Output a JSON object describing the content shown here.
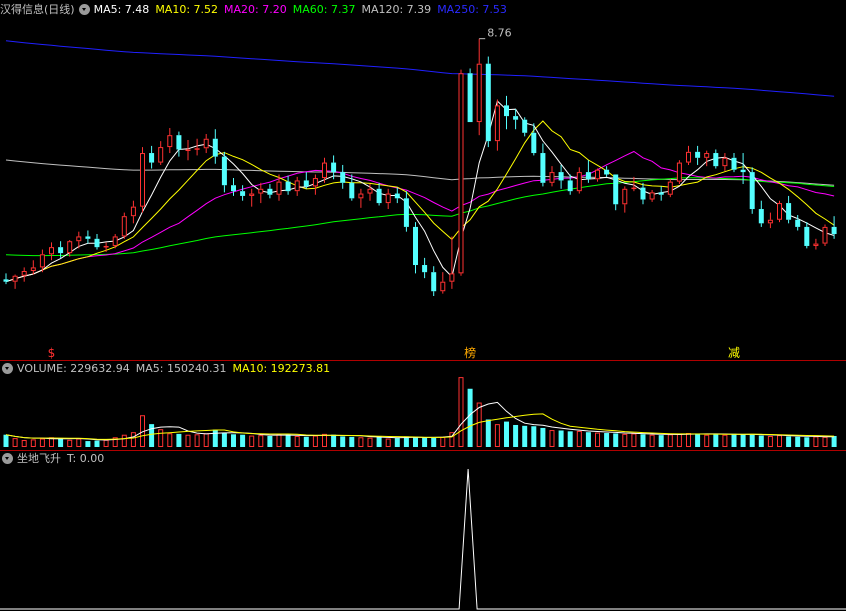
{
  "main": {
    "title": "汉得信息(日线)",
    "ma": [
      {
        "label": "MA5: 7.48",
        "color": "#ffffff"
      },
      {
        "label": "MA10: 7.52",
        "color": "#ffff00"
      },
      {
        "label": "MA20: 7.20",
        "color": "#ff00ff"
      },
      {
        "label": "MA60: 7.37",
        "color": "#00ff00"
      },
      {
        "label": "MA120: 7.39",
        "color": "#c0c0c0"
      },
      {
        "label": "MA250: 7.53",
        "color": "#0000ff"
      }
    ],
    "high_label": "8.76",
    "markers": [
      {
        "text": "$",
        "color": "#ff3030"
      },
      {
        "text": "榜",
        "color": "#ffaa00"
      },
      {
        "text": "减",
        "color": "#ffff00"
      }
    ]
  },
  "volume": {
    "labels": [
      {
        "text": "VOLUME: 229632.94",
        "color": "#c0c0c0"
      },
      {
        "text": "MA5: 150240.31",
        "color": "#c0c0c0"
      },
      {
        "text": "MA10: 192273.81",
        "color": "#ffff00"
      }
    ]
  },
  "indicator": {
    "labels": [
      {
        "text": "坐地飞升",
        "color": "#c0c0c0"
      },
      {
        "text": "T: 0.00",
        "color": "#c0c0c0"
      }
    ]
  },
  "colors": {
    "up": "#ff3232",
    "down": "#54ffff",
    "separator": "#b00000"
  },
  "chart_data": {
    "type": "candlestick",
    "candles": [
      [
        6.74,
        6.79,
        6.7,
        6.72
      ],
      [
        6.72,
        6.78,
        6.66,
        6.77
      ],
      [
        6.77,
        6.84,
        6.72,
        6.81
      ],
      [
        6.81,
        6.9,
        6.78,
        6.84
      ],
      [
        6.84,
        6.99,
        6.8,
        6.95
      ],
      [
        6.95,
        7.05,
        6.9,
        7.01
      ],
      [
        7.01,
        7.06,
        6.92,
        6.96
      ],
      [
        6.96,
        7.07,
        6.93,
        7.06
      ],
      [
        7.06,
        7.14,
        7.0,
        7.1
      ],
      [
        7.1,
        7.15,
        7.04,
        7.08
      ],
      [
        7.08,
        7.12,
        6.99,
        7.01
      ],
      [
        7.01,
        7.05,
        6.97,
        7.02
      ],
      [
        7.02,
        7.12,
        7.0,
        7.1
      ],
      [
        7.1,
        7.3,
        7.08,
        7.27
      ],
      [
        7.27,
        7.4,
        7.21,
        7.35
      ],
      [
        7.35,
        7.85,
        7.3,
        7.8
      ],
      [
        7.8,
        7.86,
        7.67,
        7.72
      ],
      [
        7.72,
        7.9,
        7.7,
        7.85
      ],
      [
        7.85,
        8.01,
        7.8,
        7.95
      ],
      [
        7.95,
        7.98,
        7.77,
        7.83
      ],
      [
        7.83,
        7.91,
        7.74,
        7.83
      ],
      [
        7.83,
        7.92,
        7.78,
        7.84
      ],
      [
        7.84,
        7.96,
        7.8,
        7.92
      ],
      [
        7.92,
        8.0,
        7.71,
        7.77
      ],
      [
        7.77,
        7.81,
        7.47,
        7.53
      ],
      [
        7.53,
        7.59,
        7.44,
        7.48
      ],
      [
        7.48,
        7.53,
        7.4,
        7.44
      ],
      [
        7.44,
        7.5,
        7.35,
        7.46
      ],
      [
        7.46,
        7.55,
        7.38,
        7.5
      ],
      [
        7.5,
        7.54,
        7.42,
        7.45
      ],
      [
        7.45,
        7.62,
        7.4,
        7.56
      ],
      [
        7.56,
        7.61,
        7.45,
        7.48
      ],
      [
        7.48,
        7.6,
        7.44,
        7.57
      ],
      [
        7.57,
        7.64,
        7.5,
        7.52
      ],
      [
        7.52,
        7.62,
        7.45,
        7.59
      ],
      [
        7.59,
        7.76,
        7.55,
        7.72
      ],
      [
        7.72,
        7.78,
        7.58,
        7.64
      ],
      [
        7.64,
        7.7,
        7.5,
        7.55
      ],
      [
        7.55,
        7.62,
        7.4,
        7.42
      ],
      [
        7.42,
        7.5,
        7.34,
        7.46
      ],
      [
        7.46,
        7.54,
        7.4,
        7.5
      ],
      [
        7.5,
        7.55,
        7.36,
        7.38
      ],
      [
        7.38,
        7.5,
        7.33,
        7.46
      ],
      [
        7.46,
        7.51,
        7.38,
        7.42
      ],
      [
        7.42,
        7.48,
        7.14,
        7.18
      ],
      [
        7.18,
        7.22,
        6.79,
        6.86
      ],
      [
        6.86,
        6.92,
        6.75,
        6.8
      ],
      [
        6.8,
        6.85,
        6.6,
        6.64
      ],
      [
        6.64,
        6.8,
        6.62,
        6.72
      ],
      [
        6.72,
        7.1,
        6.66,
        6.79
      ],
      [
        6.79,
        8.5,
        6.77,
        8.47
      ],
      [
        8.47,
        8.51,
        8.06,
        8.06
      ],
      [
        8.06,
        8.76,
        7.95,
        8.55
      ],
      [
        8.55,
        8.61,
        7.85,
        7.9
      ],
      [
        7.9,
        8.25,
        7.82,
        8.2
      ],
      [
        8.2,
        8.28,
        8.0,
        8.11
      ],
      [
        8.11,
        8.17,
        8.0,
        8.08
      ],
      [
        8.08,
        8.1,
        7.94,
        7.97
      ],
      [
        7.97,
        8.05,
        7.78,
        7.8
      ],
      [
        7.8,
        7.88,
        7.52,
        7.55
      ],
      [
        7.55,
        7.69,
        7.52,
        7.64
      ],
      [
        7.64,
        7.7,
        7.5,
        7.57
      ],
      [
        7.57,
        7.62,
        7.45,
        7.48
      ],
      [
        7.48,
        7.68,
        7.46,
        7.64
      ],
      [
        7.64,
        7.74,
        7.55,
        7.58
      ],
      [
        7.58,
        7.67,
        7.56,
        7.66
      ],
      [
        7.66,
        7.69,
        7.6,
        7.62
      ],
      [
        7.62,
        7.62,
        7.32,
        7.37
      ],
      [
        7.37,
        7.52,
        7.3,
        7.5
      ],
      [
        7.5,
        7.6,
        7.48,
        7.51
      ],
      [
        7.51,
        7.55,
        7.37,
        7.41
      ],
      [
        7.41,
        7.49,
        7.39,
        7.47
      ],
      [
        7.47,
        7.52,
        7.4,
        7.45
      ],
      [
        7.45,
        7.58,
        7.43,
        7.56
      ],
      [
        7.56,
        7.74,
        7.54,
        7.72
      ],
      [
        7.72,
        7.86,
        7.7,
        7.81
      ],
      [
        7.81,
        7.86,
        7.7,
        7.76
      ],
      [
        7.76,
        7.82,
        7.69,
        7.8
      ],
      [
        7.8,
        7.83,
        7.67,
        7.69
      ],
      [
        7.69,
        7.8,
        7.65,
        7.76
      ],
      [
        7.76,
        7.8,
        7.64,
        7.66
      ],
      [
        7.66,
        7.8,
        7.54,
        7.64
      ],
      [
        7.64,
        7.68,
        7.29,
        7.33
      ],
      [
        7.33,
        7.4,
        7.18,
        7.21
      ],
      [
        7.21,
        7.3,
        7.17,
        7.24
      ],
      [
        7.24,
        7.4,
        7.22,
        7.38
      ],
      [
        7.38,
        7.44,
        7.21,
        7.24
      ],
      [
        7.24,
        7.28,
        7.15,
        7.18
      ],
      [
        7.18,
        7.22,
        7.0,
        7.02
      ],
      [
        7.02,
        7.08,
        6.99,
        7.04
      ],
      [
        7.04,
        7.2,
        7.02,
        7.18
      ],
      [
        7.18,
        7.27,
        7.08,
        7.12
      ]
    ],
    "volume": [
      58000,
      42000,
      33000,
      36000,
      40000,
      46000,
      40000,
      34000,
      40000,
      28000,
      30000,
      34000,
      46000,
      58000,
      70000,
      150000,
      108000,
      84000,
      65000,
      62000,
      58000,
      60000,
      65000,
      82000,
      68000,
      60000,
      58000,
      54000,
      56000,
      52000,
      60000,
      58000,
      52000,
      48000,
      54000,
      62000,
      58000,
      50000,
      48000,
      46000,
      44000,
      48000,
      40000,
      42000,
      50000,
      48000,
      44000,
      43000,
      48000,
      70000,
      330000,
      275000,
      210000,
      130000,
      108000,
      120000,
      104000,
      100000,
      98000,
      90000,
      80000,
      78000,
      74000,
      76000,
      70000,
      68000,
      66000,
      64000,
      62000,
      64000,
      60000,
      58000,
      56000,
      60000,
      62000,
      66000,
      64000,
      58000,
      60000,
      58000,
      62000,
      60000,
      58000,
      54000,
      52000,
      56000,
      50000,
      48000,
      46000,
      50000,
      48000,
      52000
    ],
    "indicator_t": {
      "peak_bar": 51,
      "peak_value": 1
    },
    "price_range": [
      6.6,
      8.9
    ],
    "volume_range": [
      0,
      340000
    ]
  }
}
